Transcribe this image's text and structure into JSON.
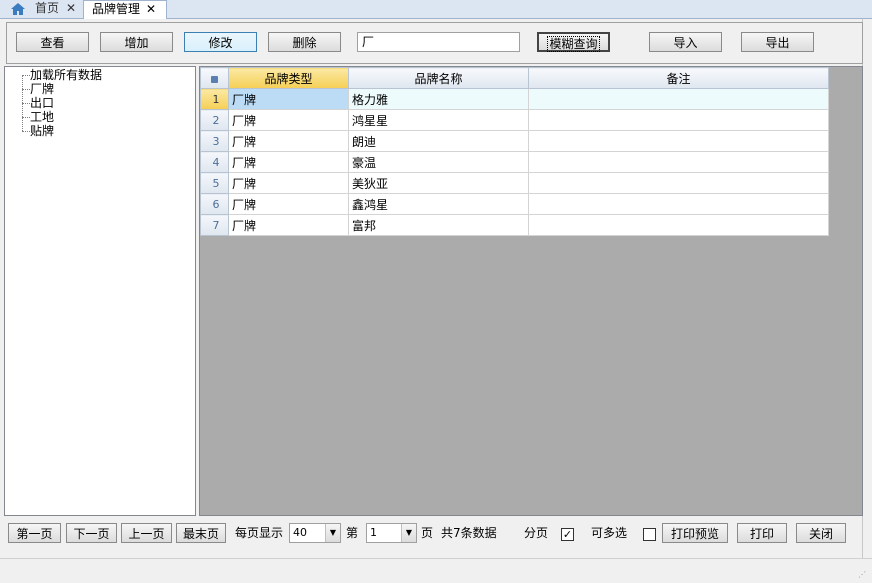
{
  "tabs": [
    {
      "label": "首页",
      "icon": "home-icon"
    },
    {
      "label": "品牌管理",
      "active": true
    }
  ],
  "toolbar": {
    "view_label": "查看",
    "add_label": "增加",
    "edit_label": "修改",
    "delete_label": "删除",
    "search_value": "厂",
    "fuzzy_search_label": "模糊查询",
    "import_label": "导入",
    "export_label": "导出"
  },
  "tree": {
    "items": [
      "加载所有数据",
      "厂牌",
      "出口",
      "工地",
      "贴牌"
    ]
  },
  "grid": {
    "columns": [
      "品牌类型",
      "品牌名称",
      "备注"
    ],
    "rows": [
      {
        "num": "1",
        "type": "厂牌",
        "name": "格力雅",
        "remark": ""
      },
      {
        "num": "2",
        "type": "厂牌",
        "name": "鸿星星",
        "remark": ""
      },
      {
        "num": "3",
        "type": "厂牌",
        "name": "朗迪",
        "remark": ""
      },
      {
        "num": "4",
        "type": "厂牌",
        "name": "豪温",
        "remark": ""
      },
      {
        "num": "5",
        "type": "厂牌",
        "name": "美狄亚",
        "remark": ""
      },
      {
        "num": "6",
        "type": "厂牌",
        "name": "鑫鸿星",
        "remark": ""
      },
      {
        "num": "7",
        "type": "厂牌",
        "name": "富邦",
        "remark": ""
      }
    ]
  },
  "pager": {
    "first_label": "第一页",
    "next_label": "下一页",
    "prev_label": "上一页",
    "last_label": "最末页",
    "per_page_label": "每页显示",
    "per_page_value": "40",
    "page_prefix": "第",
    "page_value": "1",
    "page_suffix": "页",
    "total_text": "共7条数据",
    "paging_label": "分页",
    "paging_checked": true,
    "multiselect_label": "可多选",
    "multiselect_checked": false,
    "print_preview_label": "打印预览",
    "print_label": "打印",
    "close_label": "关闭"
  },
  "colors": {
    "header_selected": "#f5cf55",
    "current_cell": "#bcdcf6",
    "grid_background": "#ababab",
    "tabbar": "#dce6f2"
  }
}
